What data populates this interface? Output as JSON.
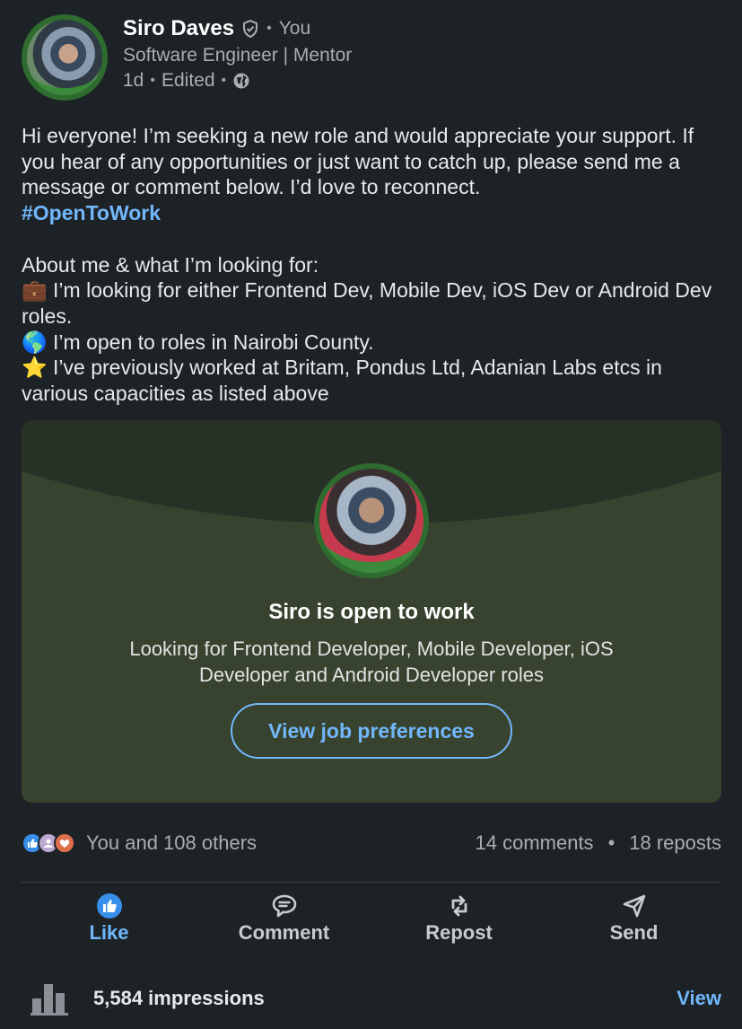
{
  "author": {
    "name": "Siro Daves",
    "you_label": "You",
    "headline": "Software Engineer | Mentor",
    "time": "1d",
    "edited": "Edited",
    "avatar_badge": "#OPENTOWORK"
  },
  "post": {
    "para1": "Hi everyone! I’m seeking a new role and would appreciate your support. If you hear of any opportunities or just want to catch up, please send me a message or comment below. I’d love to reconnect.",
    "hashtag": "#OpenToWork",
    "about_heading": "About me & what I’m looking for:",
    "line1_emoji": "💼",
    "line1": "I’m looking for either Frontend Dev, Mobile Dev, iOS Dev or Android Dev roles.",
    "line2_emoji": "🌎",
    "line2": "I’m open to roles in Nairobi County.",
    "line3_emoji": "⭐",
    "line3": "I’ve previously worked at Britam, Pondus Ltd, Adanian Labs etcs in various capacities as listed above"
  },
  "otw_card": {
    "title": "Siro is open to work",
    "description": "Looking for Frontend Developer, Mobile Developer, iOS Developer and Android Developer roles",
    "button_label": "View job preferences",
    "avatar_badge": "#OPENTOWORK"
  },
  "social": {
    "reactions_text": "You and 108 others",
    "comments": "14 comments",
    "separator": "•",
    "reposts": "18 reposts"
  },
  "actions": {
    "like": "Like",
    "comment": "Comment",
    "repost": "Repost",
    "send": "Send"
  },
  "impressions": {
    "text": "5,584 impressions",
    "view_label": "View"
  },
  "colors": {
    "background": "#1d2226",
    "accent_blue": "#71b7fb",
    "card_green": "#38432f",
    "open_to_work_green": "#2e6b2f"
  }
}
